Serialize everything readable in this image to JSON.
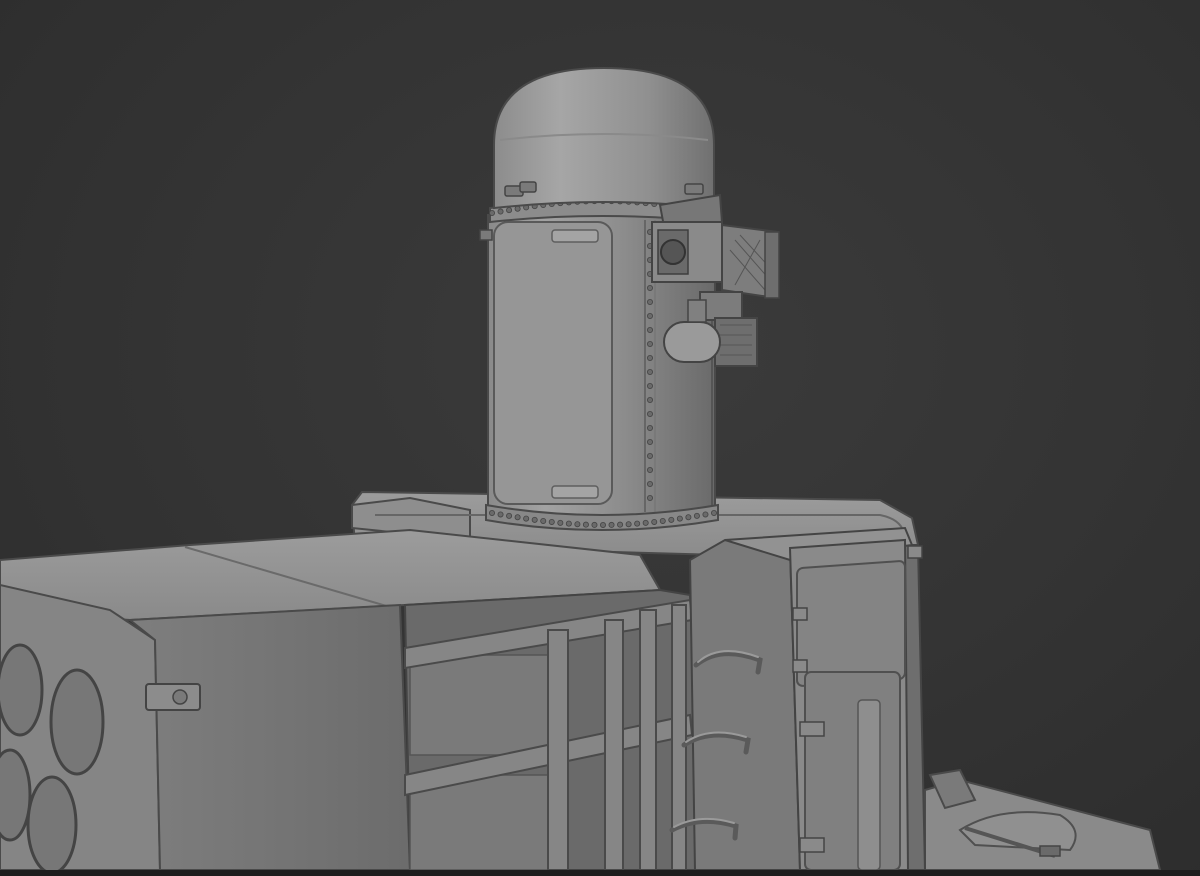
{
  "scene": {
    "colors": {
      "background": "#343434",
      "model_base": "#7f7f7f",
      "model_light": "#9a9a9a",
      "model_dark": "#5a5a5a",
      "edge": "#3e3e3e"
    },
    "objects": [
      "radar-dome",
      "turret-cylinder",
      "sensor-pod",
      "launcher-box",
      "hull-deck",
      "access-ladder",
      "side-hatch",
      "rear-deck"
    ]
  }
}
